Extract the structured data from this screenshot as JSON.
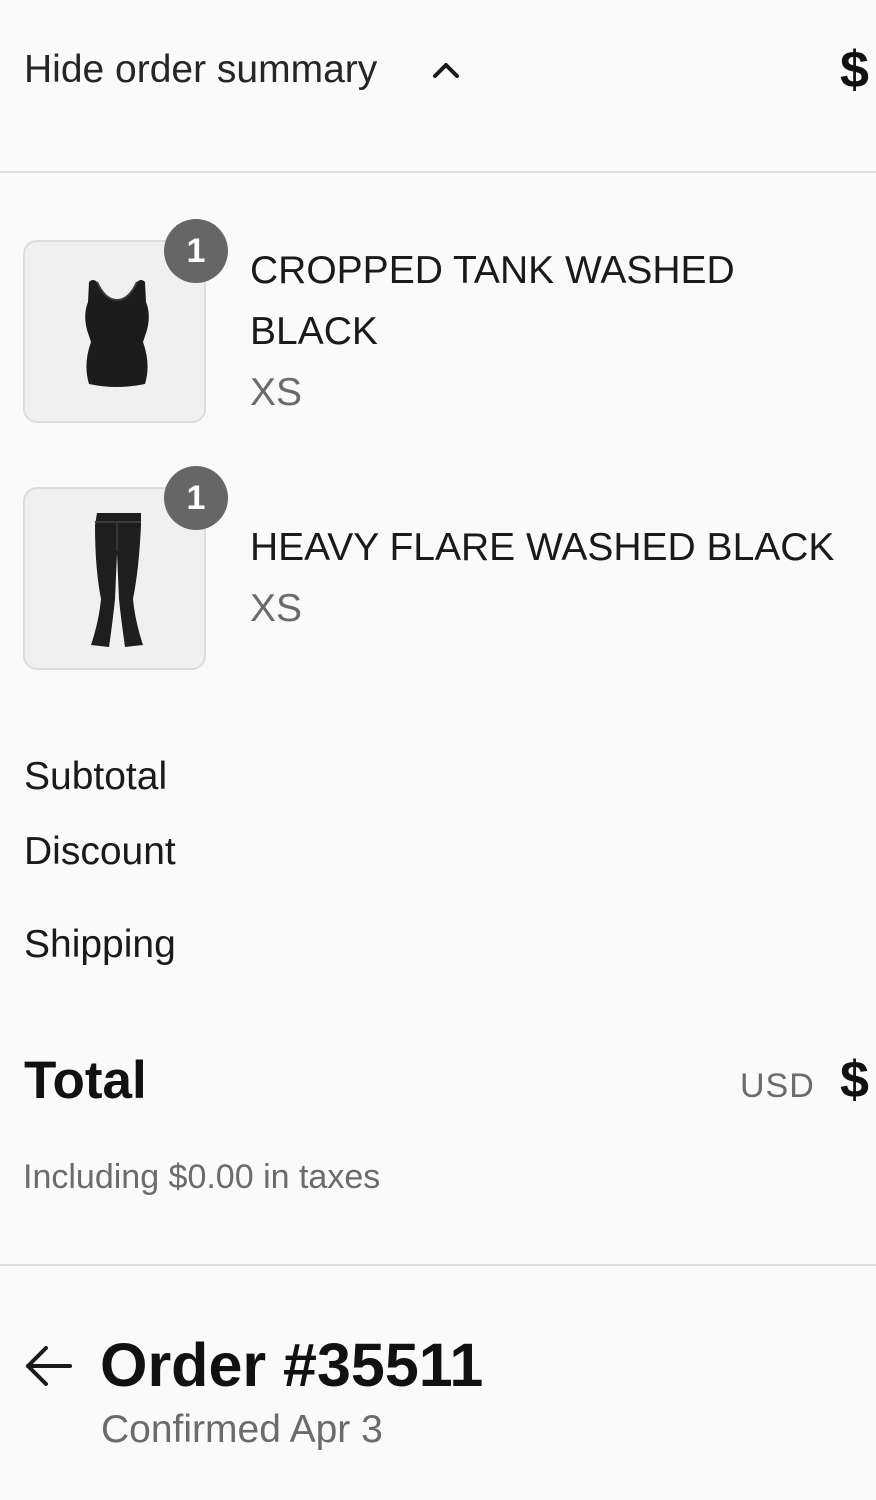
{
  "summary": {
    "toggle_label": "Hide order summary",
    "price": "$"
  },
  "items": [
    {
      "badge": "1",
      "name": "CROPPED TANK WASHED BLACK",
      "variant": "XS",
      "image_icon": "tank-top-icon"
    },
    {
      "badge": "1",
      "name": "HEAVY FLARE WASHED BLACK",
      "variant": "XS",
      "image_icon": "flare-pants-icon"
    }
  ],
  "costs": {
    "subtotal_label": "Subtotal",
    "discount_label": "Discount",
    "shipping_label": "Shipping"
  },
  "total": {
    "label": "Total",
    "currency": "USD",
    "price": "$",
    "taxes_note": "Including $0.00 in taxes"
  },
  "order": {
    "title": "Order #35511",
    "subtitle": "Confirmed Apr 3"
  },
  "colors": {
    "background": "#fafafa",
    "badge": "#666666",
    "muted_text": "#6b6b6b",
    "divider": "#dedede"
  }
}
